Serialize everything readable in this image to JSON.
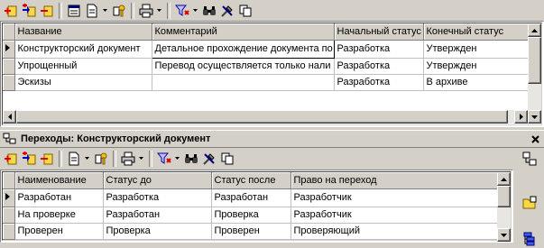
{
  "top_grid": {
    "columns": [
      "Название",
      "Комментарий",
      "Начальный статус",
      "Конечный статус"
    ],
    "rows": [
      [
        "Конструкторский документ",
        "Детальное прохождение документа по",
        "Разработка",
        "Утвержден"
      ],
      [
        "Упрощенный",
        "Перевод осуществляется только нали",
        "Разработка",
        "Утвержден"
      ],
      [
        "Эскизы",
        "",
        "Разработка",
        "В архиве"
      ]
    ]
  },
  "transitions_panel": {
    "title": "Переходы: Конструкторский документ"
  },
  "bottom_grid": {
    "columns": [
      "Наименование",
      "Статус до",
      "Статус после",
      "Право на переход"
    ],
    "rows": [
      [
        "Разработан",
        "Разработка",
        "Разработан",
        "Разработчик"
      ],
      [
        "На проверке",
        "Разработан",
        "Проверка",
        "Разработчик"
      ],
      [
        "Проверен",
        "Проверка",
        "Проверен",
        "Проверяющий"
      ]
    ]
  },
  "icons": [
    "add-icon",
    "add-child-icon",
    "delete-icon",
    "properties-icon",
    "document-icon",
    "key-icon",
    "print-icon",
    "filter-icon",
    "find-icon",
    "tools-icon",
    "copy-icon",
    "close-icon"
  ],
  "colors": {
    "face": "#d4d0c8",
    "window": "#ffffff",
    "title_text": "#000000"
  }
}
